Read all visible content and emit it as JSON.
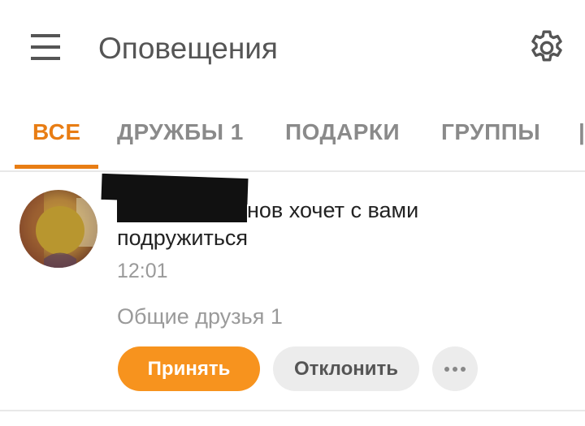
{
  "header": {
    "title": "Оповещения",
    "menu_icon": "hamburger-menu-icon",
    "settings_icon": "gear-icon"
  },
  "tabs": [
    {
      "label": "ВСЕ",
      "active": true
    },
    {
      "label": "ДРУЖБЫ 1",
      "active": false
    },
    {
      "label": "ПОДАРКИ",
      "active": false
    },
    {
      "label": "ГРУППЫ",
      "active": false
    }
  ],
  "notification": {
    "text_visible": "нов хочет с вами подружиться",
    "time": "12:01",
    "mutual_friends": "Общие друзья 1",
    "accept_label": "Принять",
    "decline_label": "Отклонить",
    "more_icon": "more-dots-icon"
  },
  "colors": {
    "accent": "#e87d14",
    "accept_button": "#f7931e",
    "secondary_button": "#ececec"
  }
}
